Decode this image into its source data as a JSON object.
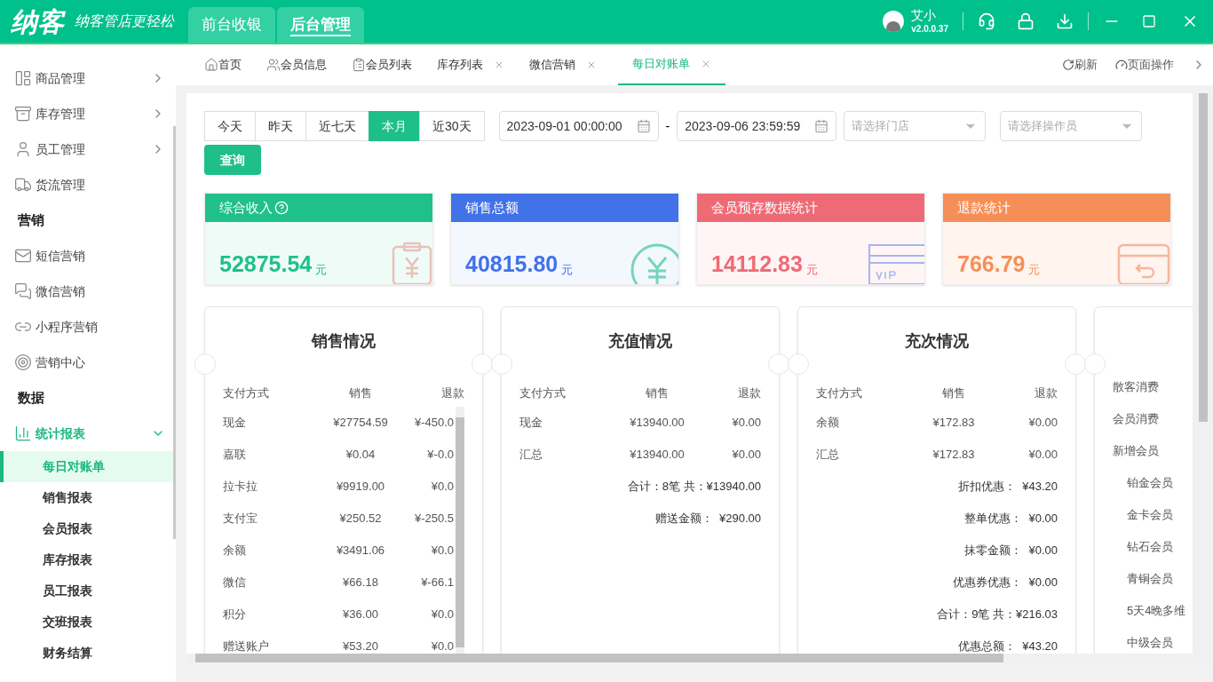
{
  "header": {
    "logo": "纳客",
    "slogan": "纳客管店更轻松",
    "modes": [
      {
        "label": "前台收银",
        "selected": false
      },
      {
        "label": "后台管理",
        "selected": true
      }
    ],
    "user": {
      "name": "艾小",
      "version": "v2.0.0.37"
    }
  },
  "sidebar": [
    {
      "kind": "group",
      "label": "商品管理",
      "expanded": false
    },
    {
      "kind": "group",
      "label": "库存管理",
      "expanded": false
    },
    {
      "kind": "group",
      "label": "员工管理",
      "expanded": false
    },
    {
      "kind": "link",
      "label": "货流管理"
    },
    {
      "kind": "heading",
      "label": "营销"
    },
    {
      "kind": "link",
      "label": "短信营销"
    },
    {
      "kind": "link",
      "label": "微信营销"
    },
    {
      "kind": "link",
      "label": "小程序营销"
    },
    {
      "kind": "link",
      "label": "营销中心"
    },
    {
      "kind": "heading",
      "label": "数据"
    },
    {
      "kind": "group",
      "label": "统计报表",
      "expanded": true,
      "children": [
        {
          "label": "每日对账单",
          "selected": true
        },
        {
          "label": "销售报表",
          "selected": false
        },
        {
          "label": "会员报表",
          "selected": false
        },
        {
          "label": "库存报表",
          "selected": false
        },
        {
          "label": "员工报表",
          "selected": false
        },
        {
          "label": "交班报表",
          "selected": false
        },
        {
          "label": "财务结算",
          "selected": false
        }
      ]
    }
  ],
  "page_tabs": [
    {
      "label": "首页",
      "closable": false,
      "selected": false
    },
    {
      "label": "会员信息",
      "closable": false,
      "selected": false
    },
    {
      "label": "会员列表",
      "closable": false,
      "selected": false
    },
    {
      "label": "库存列表",
      "closable": true,
      "selected": false
    },
    {
      "label": "微信营销",
      "closable": true,
      "selected": false
    },
    {
      "label": "每日对账单",
      "closable": true,
      "selected": true
    }
  ],
  "tab_actions": [
    "刷新",
    "页面操作"
  ],
  "filters": {
    "ranges": [
      {
        "label": "今天",
        "selected": false
      },
      {
        "label": "昨天",
        "selected": false
      },
      {
        "label": "近七天",
        "selected": false
      },
      {
        "label": "本月",
        "selected": true
      },
      {
        "label": "近30天",
        "selected": false
      }
    ],
    "start": "2023-09-01 00:00:00",
    "separator": "-",
    "end": "2023-09-06 23:59:59",
    "store": {
      "placeholder": "请选择门店"
    },
    "operator": {
      "placeholder": "请选择操作员"
    },
    "query": "查询"
  },
  "stat_cards": [
    {
      "title": "综合收入",
      "help": true,
      "value": "52875.54",
      "unit": "元",
      "color": "#20c08a"
    },
    {
      "title": "销售总额",
      "help": false,
      "value": "40815.80",
      "unit": "元",
      "color": "#4272e8"
    },
    {
      "title": "会员预存数据统计",
      "help": false,
      "value": "14112.83",
      "unit": "元",
      "color": "#ee6b76"
    },
    {
      "title": "退款统计",
      "help": false,
      "value": "766.79",
      "unit": "元",
      "color": "#f68f57"
    }
  ],
  "sections": [
    {
      "title": "销售情况",
      "columns": [
        "支付方式",
        "销售",
        "退款"
      ],
      "rows": [
        [
          "现金",
          "¥27754.59",
          "¥-450.0"
        ],
        [
          "嘉联",
          "¥0.04",
          "¥-0.0"
        ],
        [
          "拉卡拉",
          "¥9919.00",
          "¥0.0"
        ],
        [
          "支付宝",
          "¥250.52",
          "¥-250.5"
        ],
        [
          "余额",
          "¥3491.06",
          "¥0.0"
        ],
        [
          "微信",
          "¥66.18",
          "¥-66.1"
        ],
        [
          "积分",
          "¥36.00",
          "¥0.0"
        ],
        [
          "赠送账户",
          "¥53.20",
          "¥0.0"
        ]
      ],
      "scrollable": true
    },
    {
      "title": "充值情况",
      "columns": [
        "支付方式",
        "销售",
        "退款"
      ],
      "rows": [
        [
          "现金",
          "¥13940.00",
          "¥0.00"
        ],
        [
          "汇总",
          "¥13940.00",
          "¥0.00"
        ]
      ],
      "scrollable": false,
      "summary": [
        "合计：8笔 共：¥13940.00",
        "赠送金额：  ¥290.00"
      ]
    },
    {
      "title": "充次情况",
      "columns": [
        "支付方式",
        "销售",
        "退款"
      ],
      "rows": [
        [
          "余额",
          "¥172.83",
          "¥0.00"
        ],
        [
          "汇总",
          "¥172.83",
          "¥0.00"
        ]
      ],
      "scrollable": false,
      "summary": [
        "折扣优惠：  ¥43.20",
        "整单优惠：  ¥0.00",
        "抹零金额：  ¥0.00",
        "优惠券优惠：  ¥0.00",
        "合计：9笔 共：¥216.03",
        "优惠总额：  ¥43.20"
      ]
    }
  ],
  "consumption": [
    {
      "label": "散客消费"
    },
    {
      "label": "会员消费"
    },
    {
      "label": "新增会员",
      "children": [
        {
          "label": "铂金会员"
        },
        {
          "label": "金卡会员"
        },
        {
          "label": "钻石会员"
        },
        {
          "label": "青铜会员"
        },
        {
          "label": "5天4晚多维"
        },
        {
          "label": "中级会员"
        }
      ]
    }
  ]
}
